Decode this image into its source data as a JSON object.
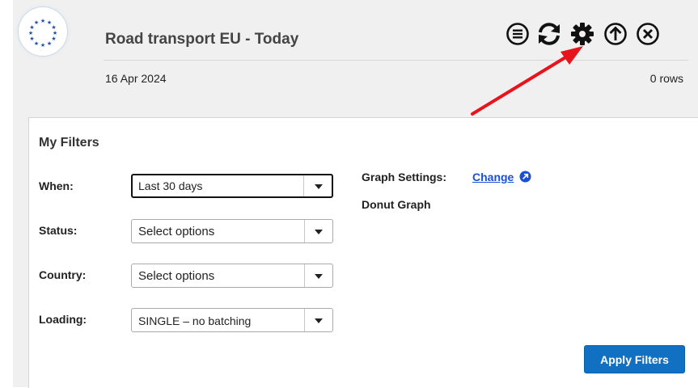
{
  "header": {
    "title": "Road transport EU - Today",
    "date": "16 Apr 2024",
    "row_count": "0 rows"
  },
  "toolbar": {
    "icons": [
      "menu-icon",
      "refresh-icon",
      "gear-icon",
      "arrow-up-icon",
      "close-icon"
    ]
  },
  "filters": {
    "heading": "My Filters",
    "fields": [
      {
        "label": "When:",
        "value": "Last 30 days"
      },
      {
        "label": "Status:",
        "value": "Select options"
      },
      {
        "label": "Country:",
        "value": "Select options"
      },
      {
        "label": "Loading:",
        "value": "SINGLE – no batching"
      }
    ],
    "graph_settings_label": "Graph Settings:",
    "graph_settings_link": "Change",
    "graph_type": "Donut Graph",
    "apply_label": "Apply Filters"
  },
  "colors": {
    "accent": "#1270c2",
    "link": "#1a4fd6",
    "annotation_arrow": "#e8141c",
    "eu_star": "#1e4fa3"
  }
}
